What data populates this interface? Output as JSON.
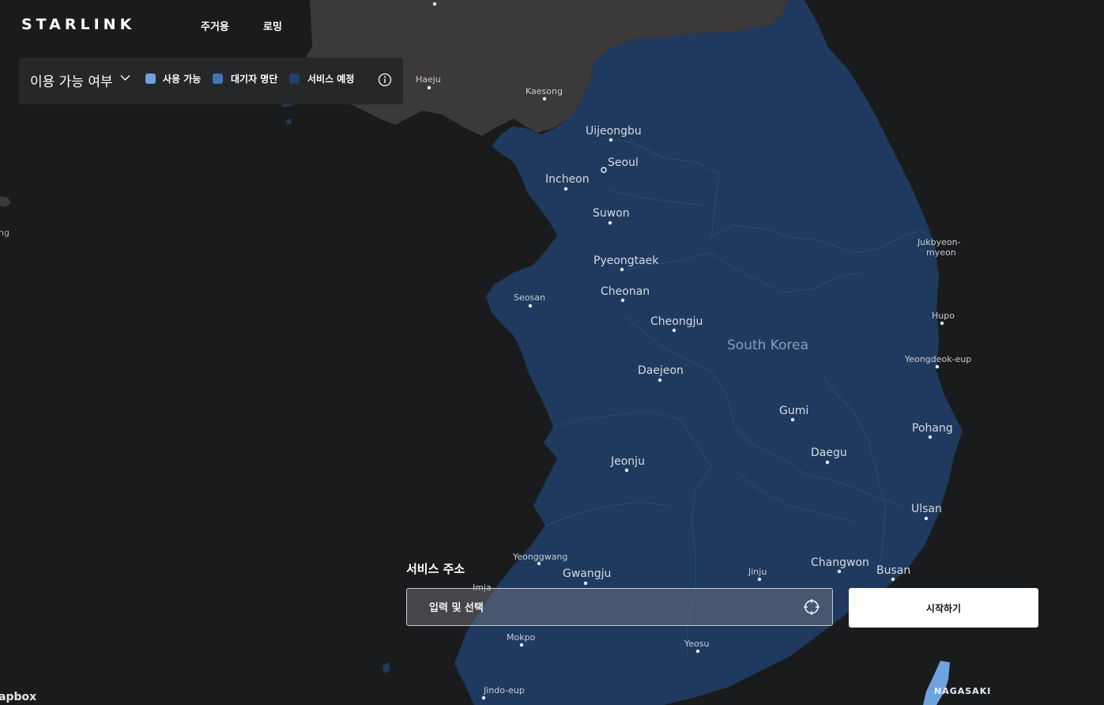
{
  "brand": {
    "logo": "STARLINK"
  },
  "nav": {
    "items": [
      {
        "label": "주거용"
      },
      {
        "label": "로밍"
      }
    ]
  },
  "legend": {
    "title": "이용 가능 여부",
    "items": [
      {
        "label": "사용 가능",
        "color": "#6ea3e0"
      },
      {
        "label": "대기자 명단",
        "color": "#3f74b8"
      },
      {
        "label": "서비스 예정",
        "color": "#23406a"
      }
    ]
  },
  "map": {
    "colors": {
      "background": "#1a1b1c",
      "north_korea_land": "#3b3939",
      "korea_service": "#1f3a5e",
      "nagasaki_available": "#6ea3e0"
    },
    "country_label": "South Korea",
    "cities": [
      "Haeju",
      "Kaesong",
      "Uijeongbu",
      "Seoul",
      "Incheon",
      "Suwon",
      "Pyeongtaek",
      "Seosan",
      "Cheonan",
      "Cheongju",
      "Daejeon",
      "Gumi",
      "Daegu",
      "Pohang",
      "Jeonju",
      "Ulsan",
      "Yeonggwang",
      "Gwangju",
      "Jinju",
      "Changwon",
      "Busan",
      "Imja",
      "Mokpo",
      "Yeosu",
      "Jindo-eup",
      "Hupo",
      "Yeongdeok-eup",
      "Jukbyeon-",
      "myeon",
      "NAGASAKI",
      "ng"
    ]
  },
  "address": {
    "label": "서비스 주소",
    "placeholder": "입력 및 선택",
    "value": ""
  },
  "start_button": {
    "label": "시작하기"
  },
  "attribution": {
    "text": "apbox"
  }
}
